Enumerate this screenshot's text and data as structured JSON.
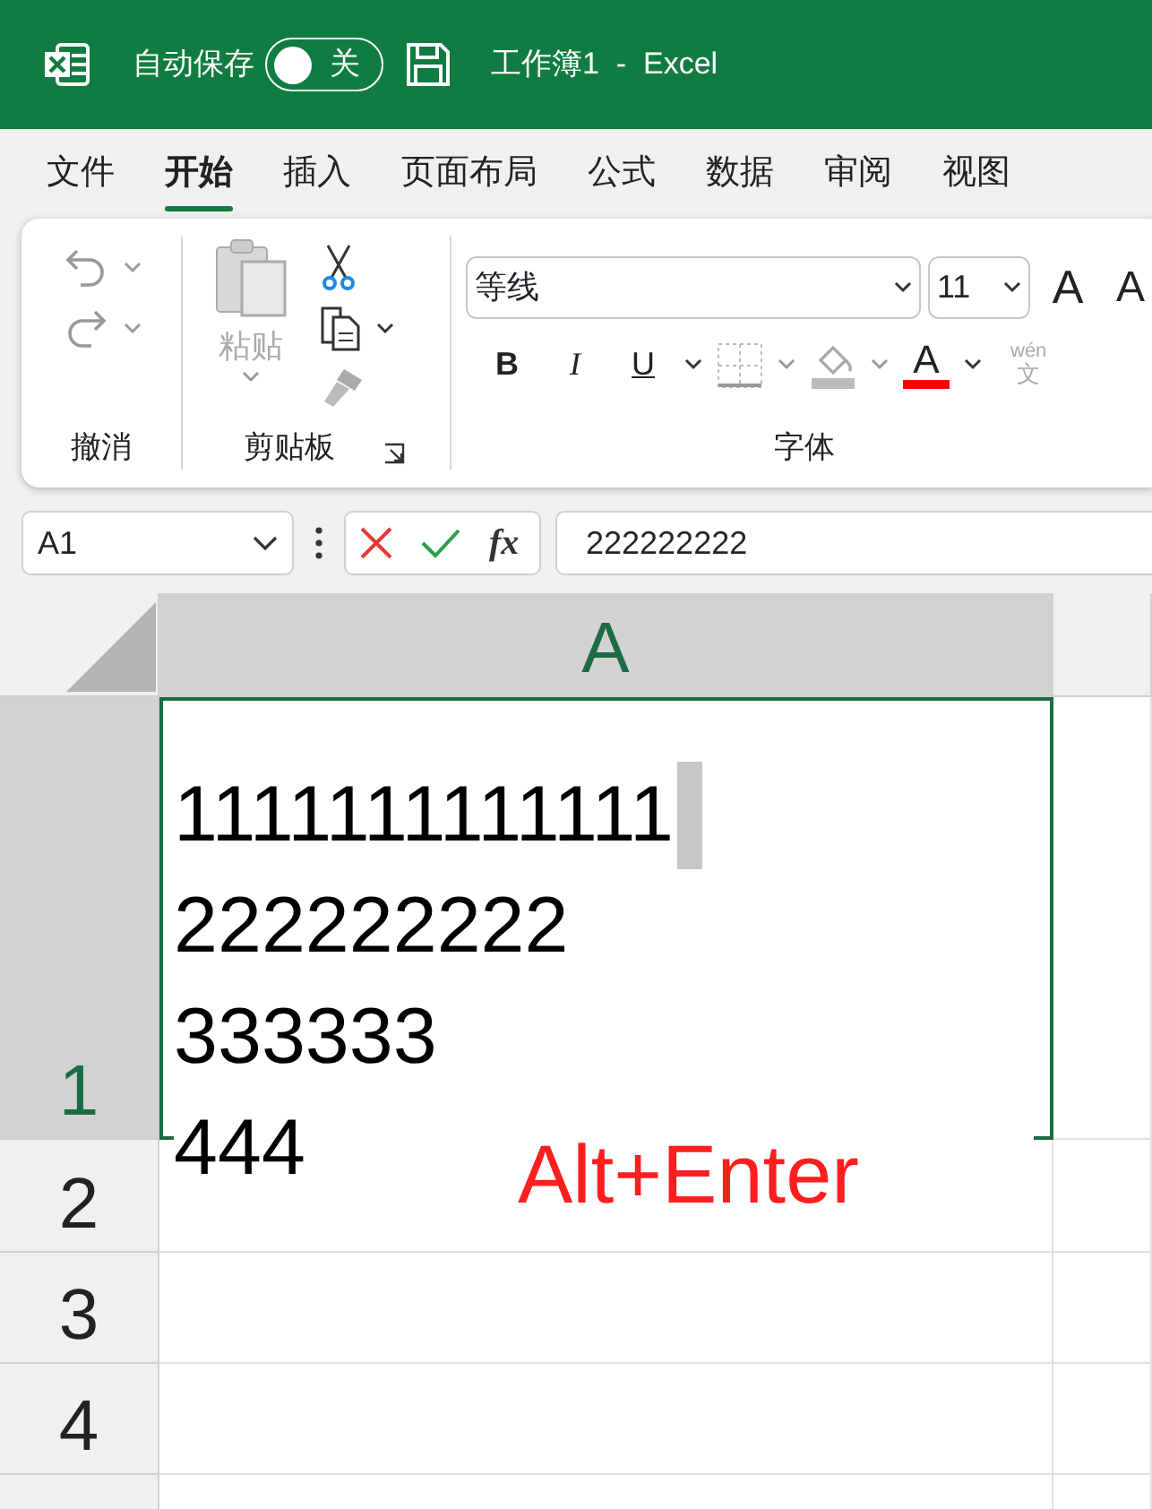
{
  "title_bar": {
    "autosave_label": "自动保存",
    "autosave": {
      "on": false,
      "label": "关"
    },
    "title": "工作簿1  -  Excel"
  },
  "tabs": [
    {
      "label": "文件",
      "selected": false
    },
    {
      "label": "开始",
      "selected": true
    },
    {
      "label": "插入",
      "selected": false
    },
    {
      "label": "页面布局",
      "selected": false
    },
    {
      "label": "公式",
      "selected": false
    },
    {
      "label": "数据",
      "selected": false
    },
    {
      "label": "审阅",
      "selected": false
    },
    {
      "label": "视图",
      "selected": false
    }
  ],
  "ribbon": {
    "undo_group": "撤消",
    "paste_label": "粘贴",
    "clipboard_group": "剪贴板",
    "font_name": "等线",
    "font_size": "11",
    "grow_font": "A",
    "shrink_font": "A",
    "bold": "B",
    "italic": "I",
    "underline": "U",
    "font_color": "A",
    "phonetic_top": "wén",
    "phonetic_bottom": "文",
    "font_group": "字体"
  },
  "formula_bar": {
    "name_box": "A1",
    "function_label": "fx",
    "content": "222222222"
  },
  "sheet": {
    "column_headers": [
      {
        "label": "A",
        "selected": true
      }
    ],
    "row_headers": [
      {
        "label": "1",
        "selected": true
      },
      {
        "label": "2",
        "selected": false
      },
      {
        "label": "3",
        "selected": false
      },
      {
        "label": "4",
        "selected": false
      }
    ],
    "active_cell_lines": [
      "1111111111111",
      "222222222",
      "333333",
      "444"
    ],
    "annotation": "Alt+Enter"
  }
}
